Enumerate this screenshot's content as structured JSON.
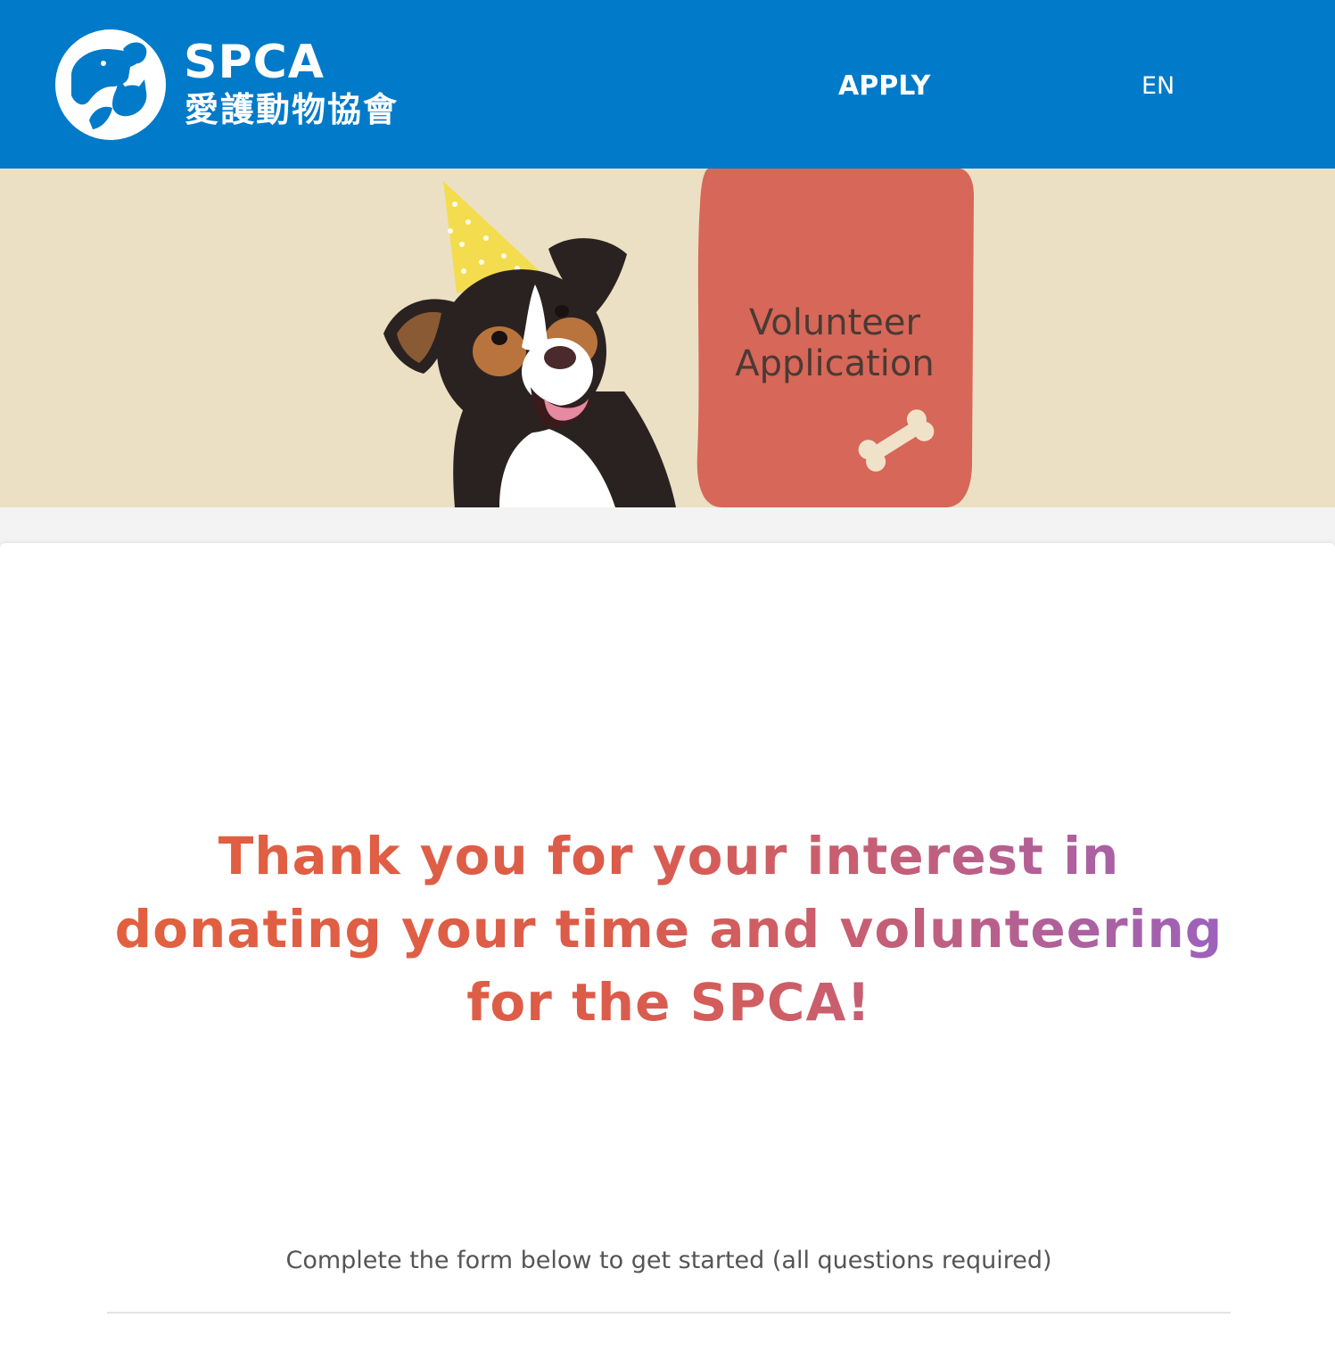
{
  "header": {
    "logo": {
      "name_en": "SPCA",
      "name_zh": "愛護動物協會",
      "icon": "dog-cat-logo-icon"
    },
    "nav": {
      "apply_label": "APPLY",
      "language_label": "EN"
    },
    "background_color": "#007ac9"
  },
  "banner": {
    "title_line1": "Volunteer",
    "title_line2": "Application",
    "image": "dog-with-party-hat-image",
    "background_color": "#ebe0c4",
    "panel_color": "#d76758"
  },
  "main": {
    "headline": "Thank you for your interest in donating your time and volunteering for the SPCA!",
    "subtext": "Complete the form below to get started (all questions required)",
    "headline_gradient": [
      "#e2603f",
      "#dc5c4a",
      "#c45f78",
      "#9b62bd"
    ]
  }
}
